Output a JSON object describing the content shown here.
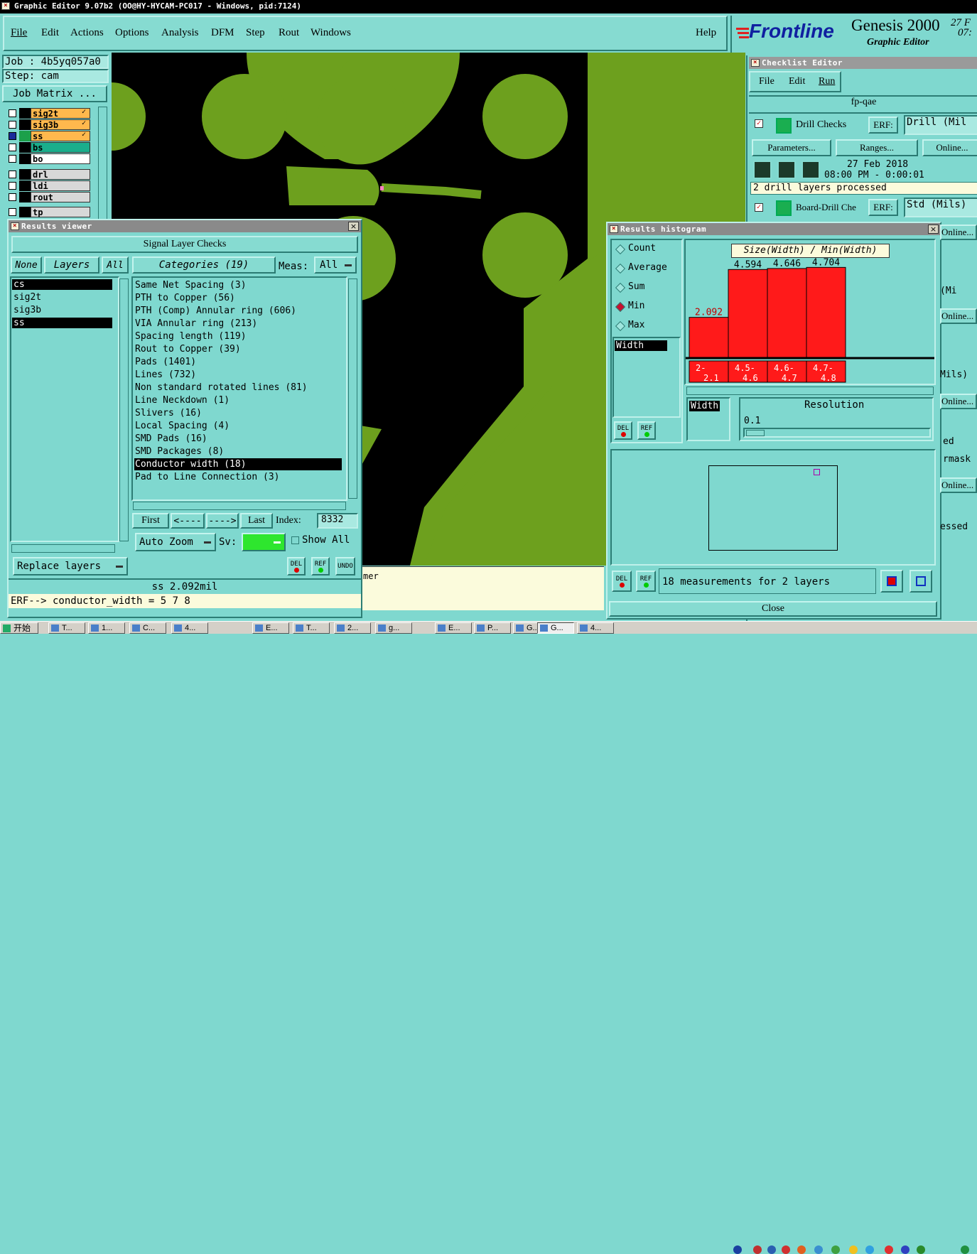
{
  "window_title": "Graphic Editor 9.07b2 (OO@HY-HYCAM-PC017 - Windows, pid:7124)",
  "menu": [
    "File",
    "Edit",
    "Actions",
    "Options",
    "Analysis",
    "DFM",
    "Step",
    "Rout",
    "Windows"
  ],
  "help_label": "Help",
  "brand": {
    "logo": "Frontline",
    "product": "Genesis 2000",
    "subtitle": "Graphic Editor",
    "date_fragment": "27 F",
    "time_fragment": "07:"
  },
  "job": {
    "job_label": "Job : 4b5yq057a0",
    "step_label": "Step: cam",
    "matrix_button": "Job Matrix ..."
  },
  "layers": [
    {
      "name": "sig2t",
      "color": "#ffb84d",
      "marker": "✓"
    },
    {
      "name": "sig3b",
      "color": "#ffb84d",
      "marker": "✓"
    },
    {
      "name": "ss",
      "color": "#ffb84d",
      "marker": "✓"
    },
    {
      "name": "bs",
      "color": "#1aae8c",
      "marker": ""
    },
    {
      "name": "bo",
      "color": "#ffffff",
      "marker": ""
    },
    {
      "name": "drl",
      "color": "#d8d8d8",
      "marker": ""
    },
    {
      "name": "ldi",
      "color": "#d8d8d8",
      "marker": ""
    },
    {
      "name": "rout",
      "color": "#d8d8d8",
      "marker": ""
    },
    {
      "name": "tp",
      "color": "#d8d8d8",
      "marker": ""
    }
  ],
  "results_viewer": {
    "title": "Results viewer",
    "header": "Signal Layer Checks",
    "none_label": "None",
    "layers_label": "Layers",
    "all_label": "All",
    "categories_label": "Categories (19)",
    "meas_label": "Meas:",
    "meas_value": "All",
    "layer_list": [
      "cs",
      "sig2t",
      "sig3b",
      "ss"
    ],
    "categories": [
      "Same Net Spacing (3)",
      "PTH to Copper (56)",
      "PTH (Comp) Annular ring (606)",
      "VIA Annular ring (213)",
      "Spacing length (119)",
      "Rout to Copper (39)",
      "Pads (1401)",
      "Lines (732)",
      "Non standard rotated lines (81)",
      "Line Neckdown (1)",
      "Slivers (16)",
      "Local Spacing (4)",
      "SMD Pads (16)",
      "SMD Packages (8)",
      "Conductor width (18)",
      "Pad to Line Connection (3)"
    ],
    "selected_category": "Conductor width (18)",
    "nav": {
      "first": "First",
      "prev": "<----",
      "next": "---->",
      "last": "Last",
      "index_label": "Index:",
      "index_value": "8332"
    },
    "auto_zoom": "Auto Zoom",
    "sv_label": "Sv:",
    "show_all": "Show All",
    "replace_layers": "Replace layers",
    "del": "DEL",
    "ref": "REF",
    "undo": "UNDO",
    "status": "ss 2.092mil",
    "erf_line": "ERF--> conductor_width = 5 7 8",
    "close_fragment": "Close"
  },
  "results_histogram": {
    "title": "Results histogram",
    "options": [
      "Count",
      "Average",
      "Sum",
      "Min",
      "Max"
    ],
    "selected_option": "Min",
    "list_item": "Width",
    "axis_select": "Width",
    "resolution_label": "Resolution",
    "resolution_value": "0.1",
    "legend_label": "Size(Width) / Min(Width)",
    "summary": "18 measurements for 2 layers",
    "close": "Close",
    "del": "DEL",
    "ref": "REF"
  },
  "chart_data": {
    "type": "bar",
    "title": "Size(Width) / Min(Width)",
    "categories": [
      "2-2.1",
      "4.5-4.6",
      "4.6-4.7",
      "4.7-4.8"
    ],
    "category_lines": [
      [
        "2-",
        "2.1"
      ],
      [
        "4.5-",
        "4.6"
      ],
      [
        "4.6-",
        "4.7"
      ],
      [
        "4.7-",
        "4.8"
      ]
    ],
    "values": [
      2.092,
      4.594,
      4.646,
      4.704
    ],
    "value_labels": [
      "2.092",
      "4.594",
      "4.646",
      "4.704"
    ],
    "ylim": [
      0,
      5.2
    ],
    "bar_color": "#ff1a1a",
    "grid": false
  },
  "checklist": {
    "title": "Checklist Editor",
    "menu": [
      "File",
      "Edit",
      "Run"
    ],
    "name": "fp-qae",
    "drill_checks": "Drill Checks",
    "erf_label": "ERF:",
    "erf_value": "Drill (Mil",
    "parameters": "Parameters...",
    "ranges": "Ranges...",
    "online": "Online...",
    "date": "27 Feb 2018",
    "time": "08:00 PM - 0:00:01",
    "status": "2 drill layers processed",
    "board_drill": "Board-Drill Che",
    "erf_value2": "Std (Mils)",
    "frag_mi": "(Mi",
    "frag_mils": "Mils)",
    "frag_ed": "ed",
    "frag_rmask": "rmask",
    "frag_essed": "essed"
  },
  "misc": {
    "mer_fragment": "mer"
  },
  "taskbar": {
    "start": "开始",
    "items": [
      "T...",
      "1...",
      "C...",
      "4...",
      "E...",
      "T...",
      "2...",
      "g...",
      "E...",
      "P...",
      "G...",
      "G...",
      "4..."
    ]
  }
}
